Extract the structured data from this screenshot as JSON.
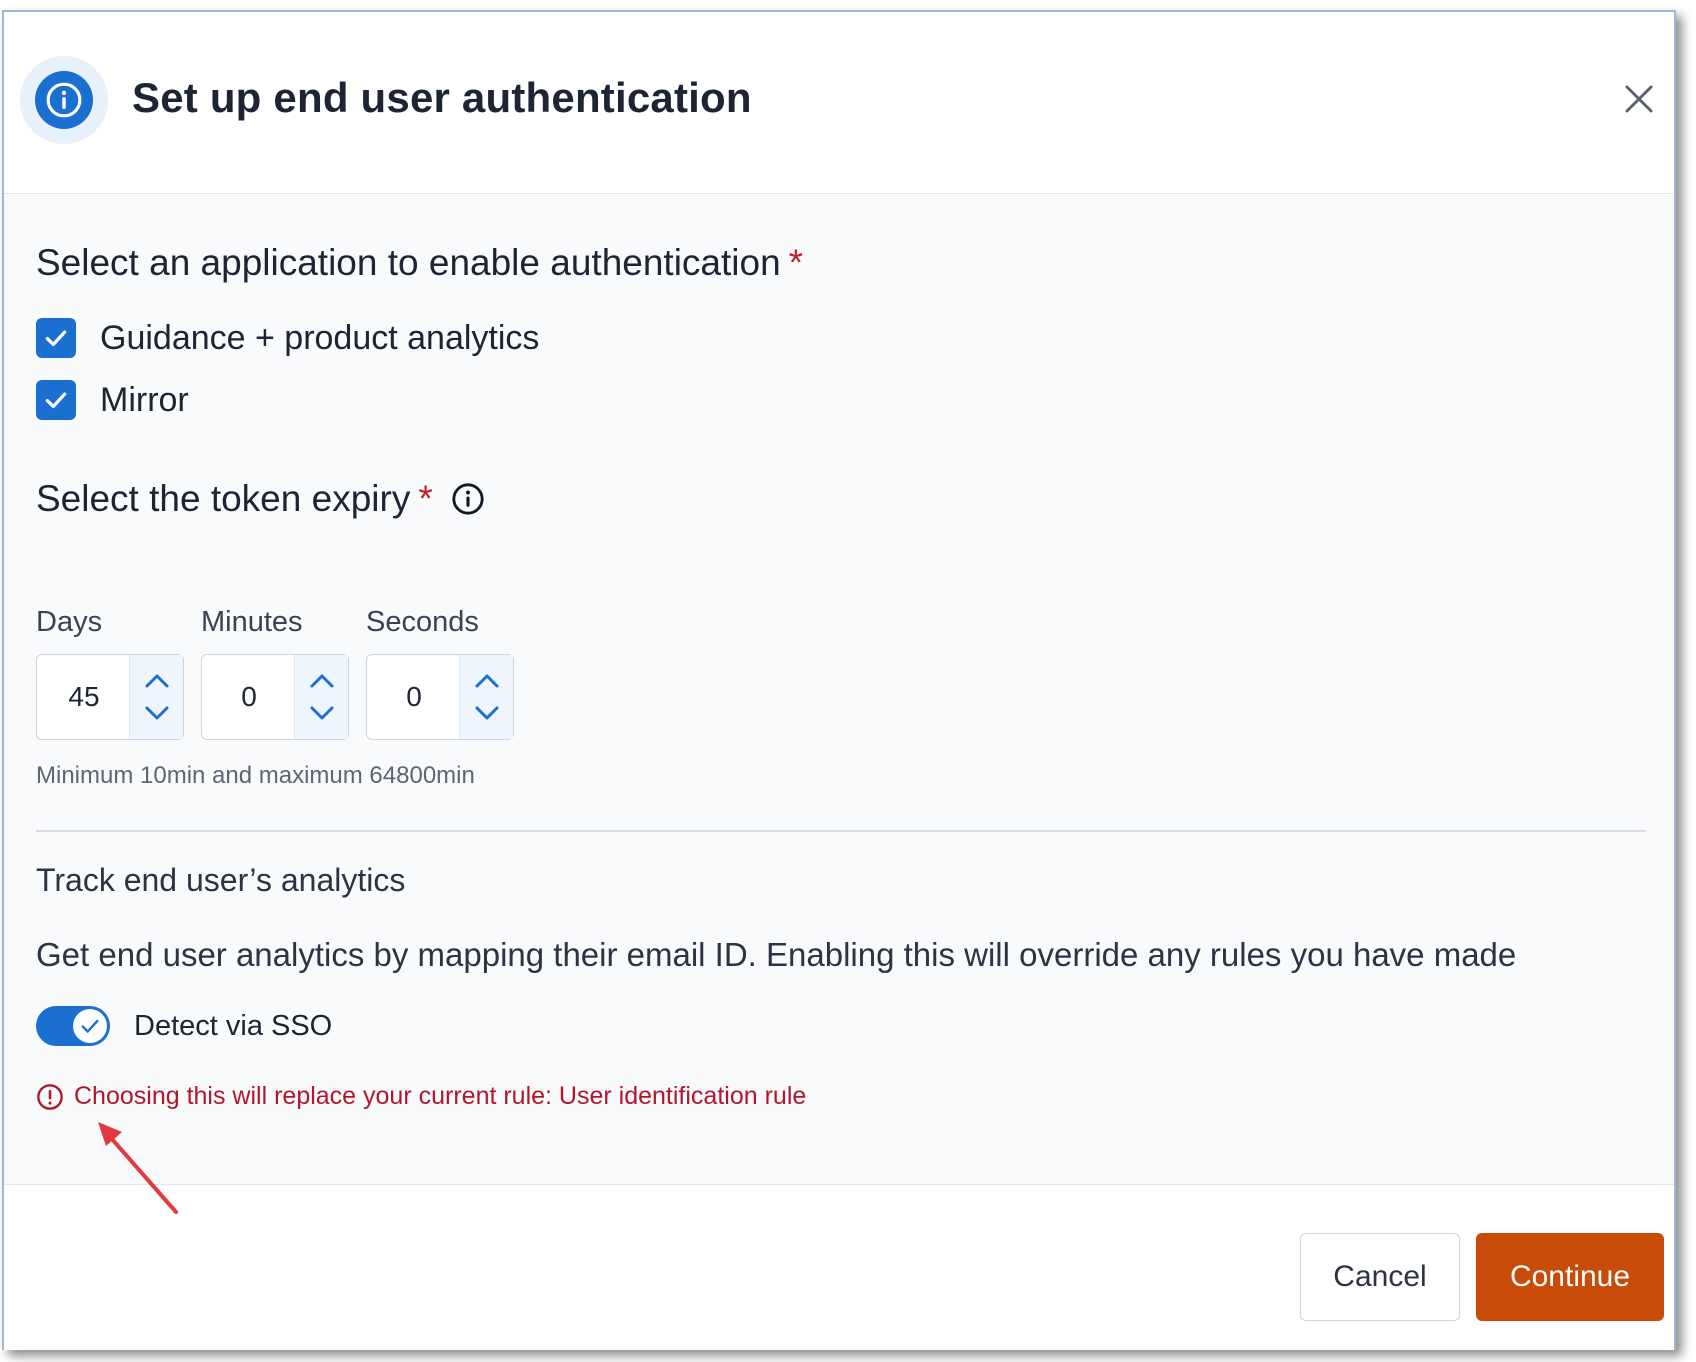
{
  "dialog": {
    "title": "Set up end user authentication",
    "header_icon": "info-icon",
    "close_icon": "close-icon"
  },
  "application_section": {
    "title": "Select an application to enable authentication",
    "required_marker": "*",
    "options": [
      {
        "label": "Guidance + product analytics",
        "checked": true
      },
      {
        "label": "Mirror",
        "checked": true
      }
    ]
  },
  "token_section": {
    "title": "Select the token expiry",
    "required_marker": "*",
    "info_icon": "info-icon",
    "fields": {
      "days": {
        "label": "Days",
        "value": "45"
      },
      "minutes": {
        "label": "Minutes",
        "value": "0"
      },
      "seconds": {
        "label": "Seconds",
        "value": "0"
      }
    },
    "hint": "Minimum 10min and maximum 64800min"
  },
  "analytics_section": {
    "title": "Track end user’s analytics",
    "description": "Get end user analytics by mapping their email ID. Enabling this will override any rules you have made",
    "toggle": {
      "label": "Detect via SSO",
      "on": true
    },
    "warning": "Choosing this will replace your current rule: User identification rule",
    "warning_icon": "alert-circle-icon"
  },
  "footer": {
    "cancel_label": "Cancel",
    "continue_label": "Continue"
  },
  "colors": {
    "primary": "#1b6fd0",
    "continue": "#c84b08",
    "error": "#b3162a",
    "annotation_arrow": "#e0393e"
  }
}
